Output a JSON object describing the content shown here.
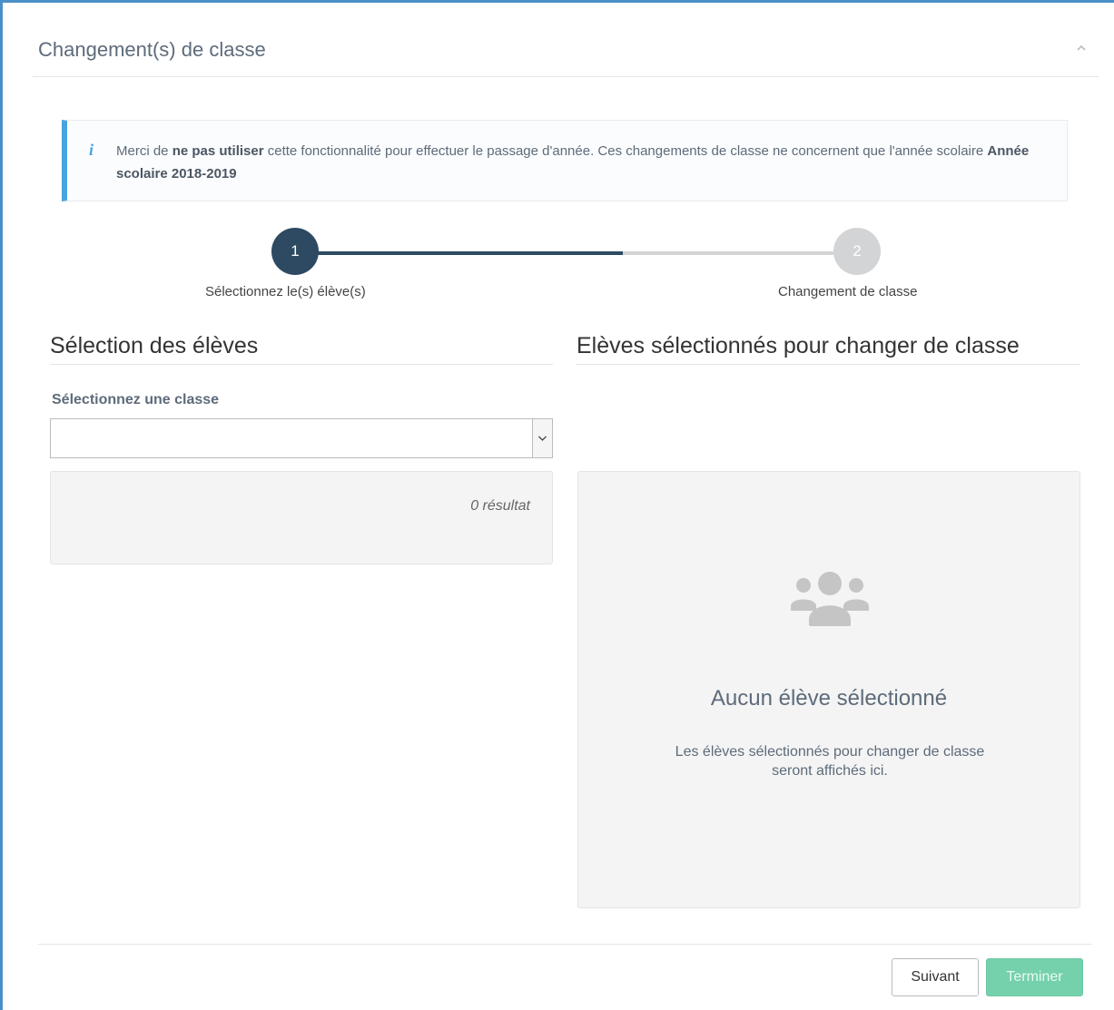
{
  "panel": {
    "title": "Changement(s) de classe",
    "collapse_icon": "chevron-up-icon"
  },
  "info": {
    "icon": "info-icon",
    "icon_glyph": "i",
    "text_part1": "Merci de ",
    "text_bold1": "ne pas utiliser",
    "text_part2": " cette fonctionnalité pour effectuer le passage d'année. Ces changements de classe ne concernent que l'année scolaire ",
    "text_bold2": "Année scolaire 2018-2019",
    "accent_color": "#4aa3df"
  },
  "stepper": {
    "steps": [
      {
        "number": "1",
        "label": "Sélectionnez le(s) élève(s)",
        "state": "active"
      },
      {
        "number": "2",
        "label": "Changement de classe",
        "state": "pending"
      }
    ],
    "progress": 0.5,
    "active_color": "#2e4a63",
    "pending_color": "#d2d4d6"
  },
  "left": {
    "title": "Sélection des élèves",
    "select_label": "Sélectionnez une classe",
    "select_value": "",
    "results_count": "0 résultat"
  },
  "right": {
    "title": "Elèves sélectionnés pour changer de classe",
    "empty_icon": "users-icon",
    "empty_title": "Aucun élève sélectionné",
    "empty_desc": "Les élèves sélectionnés pour changer de classe seront affichés ici."
  },
  "footer": {
    "next_label": "Suivant",
    "finish_label": "Terminer",
    "finish_color": "#74d1ab"
  }
}
